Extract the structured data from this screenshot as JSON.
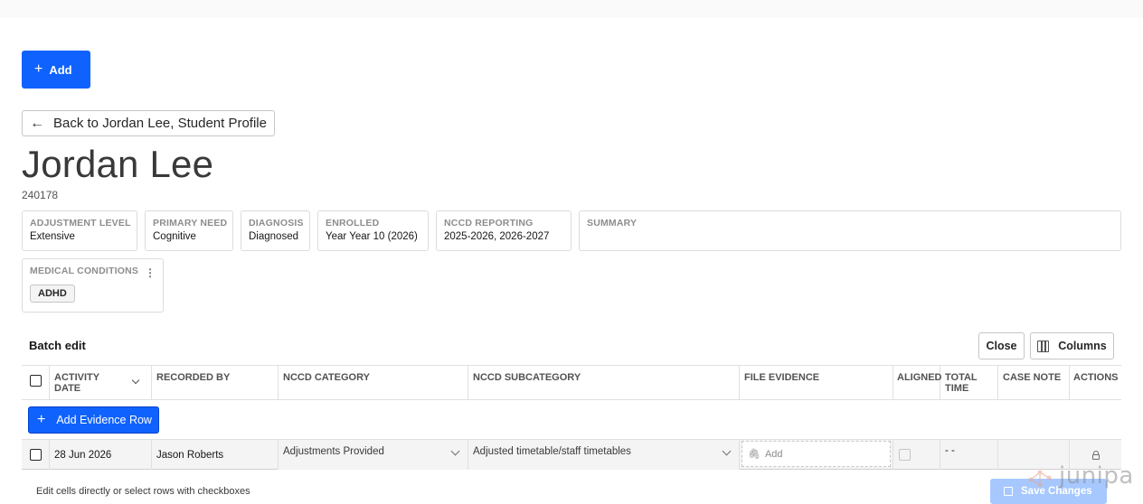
{
  "header": {
    "add_button_label": "Add"
  },
  "nav": {
    "back_label": "Back to Jordan Lee, Student Profile"
  },
  "student": {
    "name": "Jordan Lee",
    "id": "240178"
  },
  "summary_cards": [
    {
      "label": "ADJUSTMENT LEVEL",
      "value": "Extensive"
    },
    {
      "label": "PRIMARY NEED",
      "value": "Cognitive"
    },
    {
      "label": "DIAGNOSIS",
      "value": "Diagnosed"
    },
    {
      "label": "ENROLLED",
      "value": "Year Year 10 (2026)"
    },
    {
      "label": "NCCD REPORTING",
      "value": "2025-2026, 2026-2027"
    },
    {
      "label": "SUMMARY",
      "value": ""
    }
  ],
  "medical": {
    "label": "MEDICAL CONDITIONS",
    "tags": [
      "ADHD"
    ]
  },
  "batch": {
    "title": "Batch edit",
    "close_label": "Close",
    "columns_label": "Columns"
  },
  "table": {
    "columns": [
      "ACTIVITY DATE",
      "RECORDED BY",
      "NCCD CATEGORY",
      "NCCD SUBCATEGORY",
      "FILE EVIDENCE",
      "ALIGNED",
      "TOTAL TIME",
      "CASE NOTE",
      "ACTIONS"
    ],
    "add_row_label": "Add Evidence Row",
    "rows": [
      {
        "activity_date": "28 Jun 2026",
        "recorded_by": "Jason Roberts",
        "nccd_category": "Adjustments Provided",
        "nccd_subcategory": "Adjusted timetable/staff timetables",
        "file_evidence_placeholder": "Add",
        "total_time": "- -",
        "case_note": ""
      }
    ]
  },
  "footer": {
    "hint": "Edit cells directly or select rows with checkboxes",
    "save_label": "Save Changes"
  },
  "brand": {
    "watermark": "junipa",
    "primary_color": "#0f62fe"
  }
}
